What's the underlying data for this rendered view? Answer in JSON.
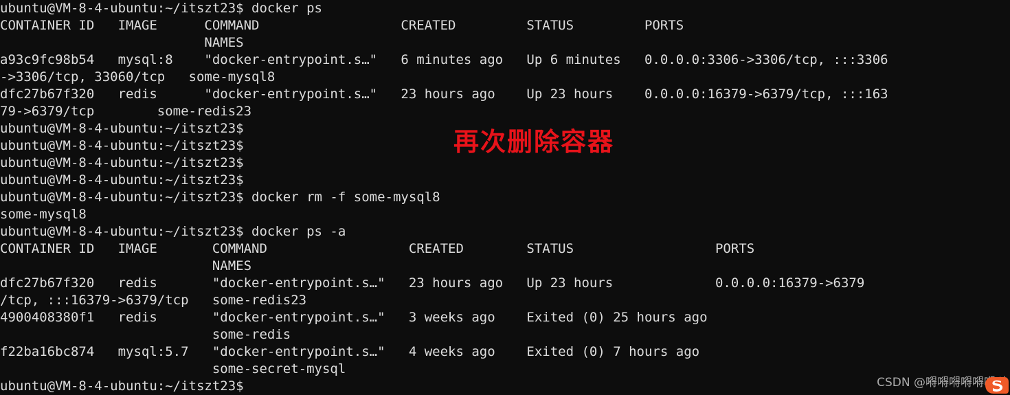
{
  "terminal": {
    "prompt": "ubuntu@VM-8-4-ubuntu:~/itszt23$",
    "background_color": "#0d0d0d",
    "text_color": "#dcdcdc",
    "lines": [
      "ubuntu@VM-8-4-ubuntu:~/itszt23$ docker ps",
      "CONTAINER ID   IMAGE      COMMAND                  CREATED         STATUS         PORTS",
      "                          NAMES",
      "a93c9fc98b54   mysql:8    \"docker-entrypoint.s…\"   6 minutes ago   Up 6 minutes   0.0.0.0:3306->3306/tcp, :::3306",
      "->3306/tcp, 33060/tcp   some-mysql8",
      "dfc27b67f320   redis      \"docker-entrypoint.s…\"   23 hours ago    Up 23 hours    0.0.0.0:16379->6379/tcp, :::163",
      "79->6379/tcp        some-redis23",
      "ubuntu@VM-8-4-ubuntu:~/itszt23$",
      "ubuntu@VM-8-4-ubuntu:~/itszt23$",
      "ubuntu@VM-8-4-ubuntu:~/itszt23$",
      "ubuntu@VM-8-4-ubuntu:~/itszt23$",
      "ubuntu@VM-8-4-ubuntu:~/itszt23$ docker rm -f some-mysql8",
      "some-mysql8",
      "ubuntu@VM-8-4-ubuntu:~/itszt23$ docker ps -a",
      "CONTAINER ID   IMAGE       COMMAND                  CREATED        STATUS                  PORTS",
      "                           NAMES",
      "dfc27b67f320   redis       \"docker-entrypoint.s…\"   23 hours ago   Up 23 hours             0.0.0.0:16379->6379",
      "/tcp, :::16379->6379/tcp   some-redis23",
      "4900408380f1   redis       \"docker-entrypoint.s…\"   3 weeks ago    Exited (0) 25 hours ago",
      "                           some-redis",
      "f22ba16bc874   mysql:5.7   \"docker-entrypoint.s…\"   4 weeks ago    Exited (0) 7 hours ago",
      "                           some-secret-mysql",
      "ubuntu@VM-8-4-ubuntu:~/itszt23$"
    ],
    "commands": [
      "docker ps",
      "docker rm -f some-mysql8",
      "docker ps -a"
    ],
    "table_headers": [
      "CONTAINER ID",
      "IMAGE",
      "COMMAND",
      "CREATED",
      "STATUS",
      "PORTS",
      "NAMES"
    ],
    "docker_ps_rows": [
      {
        "container_id": "a93c9fc98b54",
        "image": "mysql:8",
        "command": "\"docker-entrypoint.s…\"",
        "created": "6 minutes ago",
        "status": "Up 6 minutes",
        "ports": "0.0.0.0:3306->3306/tcp, :::3306->3306/tcp, 33060/tcp",
        "names": "some-mysql8"
      },
      {
        "container_id": "dfc27b67f320",
        "image": "redis",
        "command": "\"docker-entrypoint.s…\"",
        "created": "23 hours ago",
        "status": "Up 23 hours",
        "ports": "0.0.0.0:16379->6379/tcp, :::16379->6379/tcp",
        "names": "some-redis23"
      }
    ],
    "docker_ps_a_rows": [
      {
        "container_id": "dfc27b67f320",
        "image": "redis",
        "command": "\"docker-entrypoint.s…\"",
        "created": "23 hours ago",
        "status": "Up 23 hours",
        "ports": "0.0.0.0:16379->6379/tcp, :::16379->6379/tcp",
        "names": "some-redis23"
      },
      {
        "container_id": "4900408380f1",
        "image": "redis",
        "command": "\"docker-entrypoint.s…\"",
        "created": "3 weeks ago",
        "status": "Exited (0) 25 hours ago",
        "ports": "",
        "names": "some-redis"
      },
      {
        "container_id": "f22ba16bc874",
        "image": "mysql:5.7",
        "command": "\"docker-entrypoint.s…\"",
        "created": "4 weeks ago",
        "status": "Exited (0) 7 hours ago",
        "ports": "",
        "names": "some-secret-mysql"
      }
    ],
    "command_output": "some-mysql8"
  },
  "annotation": {
    "text": "再次删除容器",
    "color": "#e8131a"
  },
  "watermark": {
    "text": "CSDN @嘚嘚嘚嘚嘚嘚哒",
    "logo_color": "#f05a28"
  }
}
